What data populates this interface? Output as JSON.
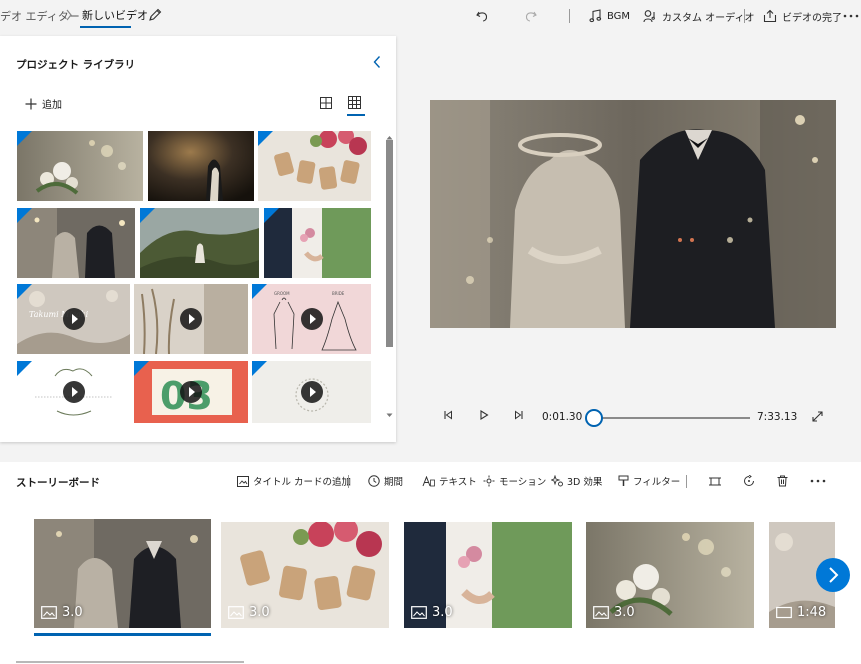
{
  "topbar": {
    "breadcrumb_root": "デオ エディター",
    "breadcrumb_current": "新しいビデオ",
    "bgm_label": "BGM",
    "custom_audio_label": "カスタム オーディオ",
    "finish_label": "ビデオの完了"
  },
  "library": {
    "title": "プロジェクト ライブラリ",
    "add_label": "追加"
  },
  "player": {
    "current_time": "0:01.30",
    "total_time": "7:33.13",
    "progress": 0.003
  },
  "storyboard": {
    "title": "ストーリーボード",
    "toolbar": {
      "title_card": "タイトル カードの追加",
      "duration": "期間",
      "text": "テキスト",
      "motion": "モーション",
      "effects_3d": "3D 効果",
      "filters": "フィルター"
    },
    "clips": [
      {
        "duration": "3.0",
        "kind": "image"
      },
      {
        "duration": "3.0",
        "kind": "image"
      },
      {
        "duration": "3.0",
        "kind": "image"
      },
      {
        "duration": "3.0",
        "kind": "image"
      },
      {
        "duration": "1:48",
        "kind": "video"
      }
    ]
  },
  "thumb_texts": {
    "takumi": "Takumi  Misaki",
    "groom": "GROOM",
    "bride": "BRIDE",
    "number": "03"
  },
  "colors": {
    "accent": "#0078d7",
    "accent_dark": "#0063b1"
  }
}
